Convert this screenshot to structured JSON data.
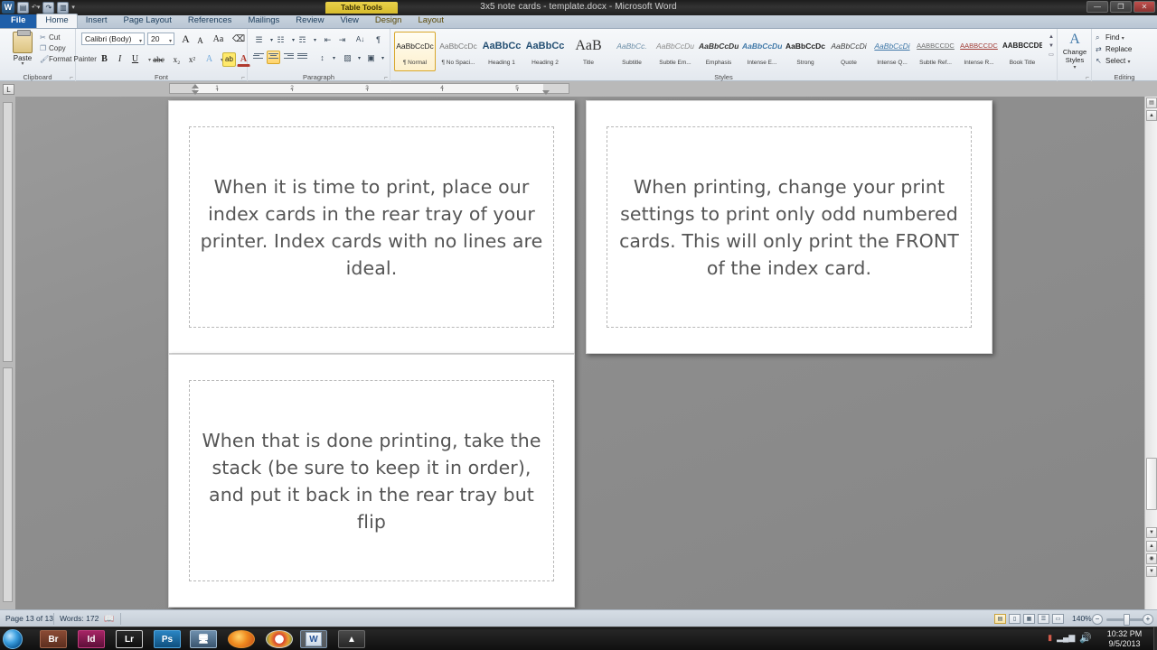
{
  "window": {
    "title": "3x5 note cards - template.docx - Microsoft Word",
    "contextual_tab_group": "Table Tools",
    "quick_access": [
      "save-icon",
      "undo-icon",
      "redo-icon",
      "print-preview-icon"
    ],
    "controls": {
      "minimize": "—",
      "restore": "❐",
      "close": "✕"
    }
  },
  "ribbon": {
    "tabs": [
      {
        "label": "File",
        "state": "file"
      },
      {
        "label": "Home",
        "state": "active"
      },
      {
        "label": "Insert",
        "state": "normal"
      },
      {
        "label": "Page Layout",
        "state": "normal"
      },
      {
        "label": "References",
        "state": "normal"
      },
      {
        "label": "Mailings",
        "state": "normal"
      },
      {
        "label": "Review",
        "state": "normal"
      },
      {
        "label": "View",
        "state": "normal"
      },
      {
        "label": "Design",
        "state": "contextual"
      },
      {
        "label": "Layout",
        "state": "contextual"
      }
    ],
    "clipboard": {
      "group_label": "Clipboard",
      "paste_label": "Paste",
      "cut_label": "Cut",
      "copy_label": "Copy",
      "format_painter_label": "Format Painter"
    },
    "font": {
      "group_label": "Font",
      "font_name": "Calibri (Body)",
      "font_size": "20",
      "grow_font": "A",
      "shrink_font": "A",
      "change_case": "Aa",
      "clear_formatting": "⌫",
      "bold": "B",
      "italic": "I",
      "underline": "U",
      "strikethrough": "abc",
      "subscript": "x₂",
      "superscript": "x²",
      "text_effects": "A",
      "highlight": "ab",
      "font_color": "A"
    },
    "paragraph": {
      "group_label": "Paragraph",
      "bullets": "☰",
      "numbering": "☷",
      "multilevel": "☶",
      "decrease_indent": "⇤",
      "increase_indent": "⇥",
      "sort": "A↓",
      "show_marks": "¶",
      "align_left": "≡",
      "align_center": "≡",
      "align_right": "≡",
      "justify": "≡",
      "line_spacing": "↕",
      "shading": "▨",
      "borders": "▣",
      "selected_alignment": "align_center"
    },
    "styles": {
      "group_label": "Styles",
      "gallery": [
        {
          "preview": "AaBbCcDc",
          "name": "¶ Normal",
          "selected": true
        },
        {
          "preview": "AaBbCcDc",
          "name": "¶ No Spaci...",
          "selected": false
        },
        {
          "preview": "AaBbCс",
          "name": "Heading 1",
          "selected": false
        },
        {
          "preview": "AaBbCc",
          "name": "Heading 2",
          "selected": false
        },
        {
          "preview": "AaB",
          "name": "Title",
          "selected": false
        },
        {
          "preview": "AaBbCc.",
          "name": "Subtitle",
          "selected": false
        },
        {
          "preview": "AaBbCcDu",
          "name": "Subtle Em...",
          "selected": false
        },
        {
          "preview": "AaBbCcDu",
          "name": "Emphasis",
          "selected": false
        },
        {
          "preview": "AaBbCcDu",
          "name": "Intense E...",
          "selected": false
        },
        {
          "preview": "AaBbCcDc",
          "name": "Strong",
          "selected": false
        },
        {
          "preview": "AaBbCcDi",
          "name": "Quote",
          "selected": false
        },
        {
          "preview": "AaBbCcDi",
          "name": "Intense Q...",
          "selected": false
        },
        {
          "preview": "AABBCCDC",
          "name": "Subtle Ref...",
          "selected": false
        },
        {
          "preview": "AABBCCDC",
          "name": "Intense R...",
          "selected": false
        },
        {
          "preview": "AABBCCDE",
          "name": "Book Title",
          "selected": false
        }
      ],
      "change_styles_label": "Change Styles"
    },
    "editing": {
      "group_label": "Editing",
      "find_label": "Find",
      "replace_label": "Replace",
      "select_label": "Select"
    }
  },
  "ruler": {
    "tab_stop_selector": "L",
    "ticks": [
      "1",
      "2",
      "3",
      "4",
      "5"
    ]
  },
  "document": {
    "cards": [
      {
        "id": "card-1",
        "text": "When it is time to print, place our index cards in the rear tray of your printer.  Index cards with no lines are ideal."
      },
      {
        "id": "card-2",
        "text": "When printing, change your print settings to print only odd numbered cards.  This will only print the FRONT of the index card."
      },
      {
        "id": "card-3",
        "text": "When that is done printing, take the stack (be sure to keep it in order), and put it back in the rear tray but flip"
      }
    ]
  },
  "status_bar": {
    "page": "Page 13 of 13",
    "words": "Words: 172",
    "proofing_icon": "spell-check-icon",
    "views": [
      "print-layout",
      "full-screen-reading",
      "web-layout",
      "outline",
      "draft"
    ],
    "selected_view": "print-layout",
    "zoom": "140%",
    "zoom_out": "−",
    "zoom_in": "+"
  },
  "taskbar": {
    "start": "start-orb-icon",
    "apps": [
      {
        "label": "Br",
        "name": "adobe-bridge-icon",
        "color": "#6b3a2b",
        "active": false
      },
      {
        "label": "Id",
        "name": "adobe-indesign-icon",
        "color": "#8e1f56",
        "active": false
      },
      {
        "label": "Lr",
        "name": "adobe-lightroom-icon",
        "color": "#1c1c1c",
        "active": false
      },
      {
        "label": "Ps",
        "name": "adobe-photoshop-icon",
        "color": "#1a6fa8",
        "active": false
      },
      {
        "label": "",
        "name": "computer-icon",
        "color": "#4a6a86",
        "active": false
      },
      {
        "label": "",
        "name": "firefox-icon",
        "color": "#d96a14",
        "active": false
      },
      {
        "label": "",
        "name": "chrome-icon",
        "color": "#d8402f",
        "active": false
      },
      {
        "label": "W",
        "name": "microsoft-word-icon",
        "color": "#2a5699",
        "active": true
      },
      {
        "label": "",
        "name": "vlc-icon",
        "color": "#d27c22",
        "active": false
      }
    ],
    "tray": [
      "battery-icon",
      "network-icon",
      "volume-icon"
    ],
    "time": "10:32 PM",
    "date": "9/5/2013"
  }
}
